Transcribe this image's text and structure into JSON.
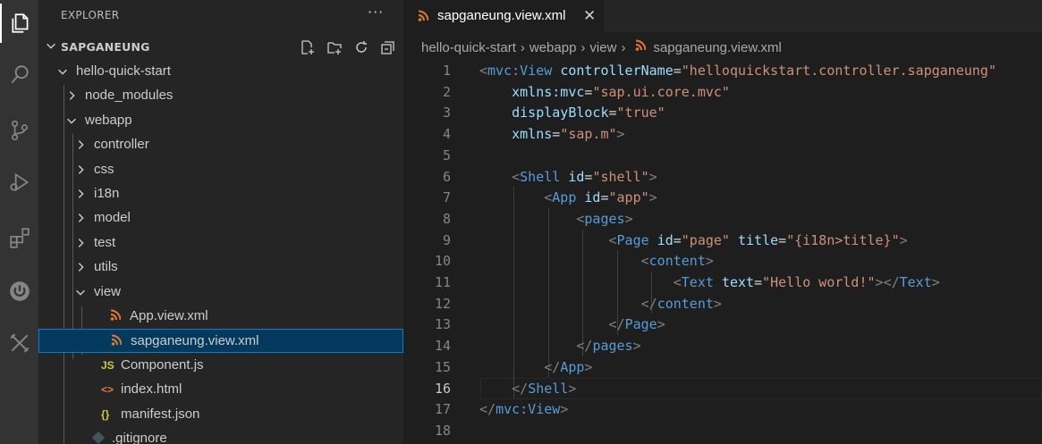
{
  "colors": {
    "activity_bar": "#333333",
    "sidebar": "#252526",
    "editor": "#1e1e1e",
    "selection": "#04395e",
    "xml_icon": "#e37933",
    "js_icon": "#cbcb41",
    "html_icon": "#e37933",
    "json_icon": "#cbcb41"
  },
  "activity_bar": {
    "icons": [
      "explorer-icon",
      "search-icon",
      "source-control-icon",
      "run-debug-icon",
      "extensions-icon",
      "power-icon",
      "tools-icon"
    ]
  },
  "sidebar": {
    "header": "EXPLORER",
    "more": "···",
    "section_title": "SAPGANEUNG",
    "section_actions": [
      "new-file-icon",
      "new-folder-icon",
      "refresh-icon",
      "collapse-all-icon"
    ],
    "items": [
      {
        "label": "hello-quick-start",
        "icon": "chevron-down",
        "file_icon": ""
      },
      {
        "label": "node_modules",
        "icon": "chevron-right",
        "file_icon": ""
      },
      {
        "label": "webapp",
        "icon": "chevron-down",
        "file_icon": ""
      },
      {
        "label": "controller",
        "icon": "chevron-right",
        "file_icon": ""
      },
      {
        "label": "css",
        "icon": "chevron-right",
        "file_icon": ""
      },
      {
        "label": "i18n",
        "icon": "chevron-right",
        "file_icon": ""
      },
      {
        "label": "model",
        "icon": "chevron-right",
        "file_icon": ""
      },
      {
        "label": "test",
        "icon": "chevron-right",
        "file_icon": ""
      },
      {
        "label": "utils",
        "icon": "chevron-right",
        "file_icon": ""
      },
      {
        "label": "view",
        "icon": "chevron-down",
        "file_icon": ""
      },
      {
        "label": "App.view.xml",
        "icon": "",
        "file_icon": "xml"
      },
      {
        "label": "sapganeung.view.xml",
        "icon": "",
        "file_icon": "xml"
      },
      {
        "label": "Component.js",
        "icon": "",
        "file_icon": "JS"
      },
      {
        "label": "index.html",
        "icon": "",
        "file_icon": "<>"
      },
      {
        "label": "manifest.json",
        "icon": "",
        "file_icon": "{}"
      },
      {
        "label": ".gitignore",
        "icon": "",
        "file_icon": "git"
      }
    ]
  },
  "editor": {
    "tab": {
      "label": "sapganeung.view.xml",
      "close": "✕"
    },
    "breadcrumb": [
      "hello-quick-start",
      "webapp",
      "view",
      "sapganeung.view.xml"
    ],
    "current_line": 16,
    "lines": [
      {
        "n": "1",
        "text": "<mvc:View controllerName=\"helloquickstart.controller.sapganeung\""
      },
      {
        "n": "2",
        "text": "    xmlns:mvc=\"sap.ui.core.mvc\""
      },
      {
        "n": "3",
        "text": "    displayBlock=\"true\""
      },
      {
        "n": "4",
        "text": "    xmlns=\"sap.m\">"
      },
      {
        "n": "5",
        "text": ""
      },
      {
        "n": "6",
        "text": "    <Shell id=\"shell\">"
      },
      {
        "n": "7",
        "text": "        <App id=\"app\">"
      },
      {
        "n": "8",
        "text": "            <pages>"
      },
      {
        "n": "9",
        "text": "                <Page id=\"page\" title=\"{i18n>title}\">"
      },
      {
        "n": "10",
        "text": "                    <content>"
      },
      {
        "n": "11",
        "text": "                        <Text text=\"Hello world!\"></Text>"
      },
      {
        "n": "12",
        "text": "                    </content>"
      },
      {
        "n": "13",
        "text": "                </Page>"
      },
      {
        "n": "14",
        "text": "            </pages>"
      },
      {
        "n": "15",
        "text": "        </App>"
      },
      {
        "n": "16",
        "text": "    </Shell>"
      },
      {
        "n": "17",
        "text": "</mvc:View>"
      },
      {
        "n": "18",
        "text": ""
      }
    ]
  }
}
